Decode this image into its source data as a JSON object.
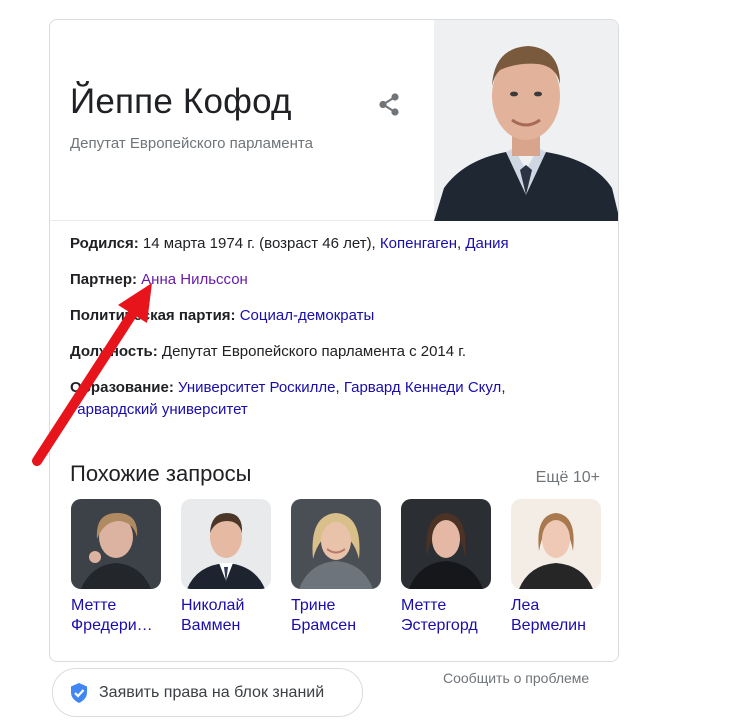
{
  "knowledge_panel": {
    "title": "Йеппе Кофод",
    "subtitle": "Депутат Европейского парламента",
    "share_icon": "share-icon",
    "facts": {
      "born": {
        "label": "Родился:",
        "text": " 14 марта 1974 г. (возраст 46 лет), ",
        "link1": "Копенгаген",
        "sep": ", ",
        "link2": "Дания"
      },
      "partner": {
        "label": "Партнер:",
        "link": "Анна Нильссон"
      },
      "party": {
        "label": "Политическая партия:",
        "link": "Социал-демократы"
      },
      "position": {
        "label": "Должность:",
        "text": " Депутат Европейского парламента с 2014 г."
      },
      "education": {
        "label": "Образование:",
        "link1": "Университет Роскилле",
        "sep1": ", ",
        "link2": "Гарвард Кеннеди Скул",
        "sep2": ",",
        "link3": "Гарвардский университет"
      }
    },
    "related": {
      "heading": "Похожие запросы",
      "more": "Ещё 10+",
      "people": [
        {
          "line1": "Метте",
          "line2": "Фредери…"
        },
        {
          "line1": "Николай",
          "line2": "Ваммен"
        },
        {
          "line1": "Трине",
          "line2": "Брамсен"
        },
        {
          "line1": "Метте",
          "line2": "Эстергорд"
        },
        {
          "line1": "Леа",
          "line2": "Вермелин"
        }
      ]
    }
  },
  "claim_button": {
    "label": "Заявить права на блок знаний",
    "icon": "shield-check-icon"
  },
  "report_link": "Сообщить о проблеме",
  "colors": {
    "link": "#1a0dab",
    "visited_link": "#681da8",
    "arrow": "#e8141c",
    "secondary_text": "#70757a"
  }
}
